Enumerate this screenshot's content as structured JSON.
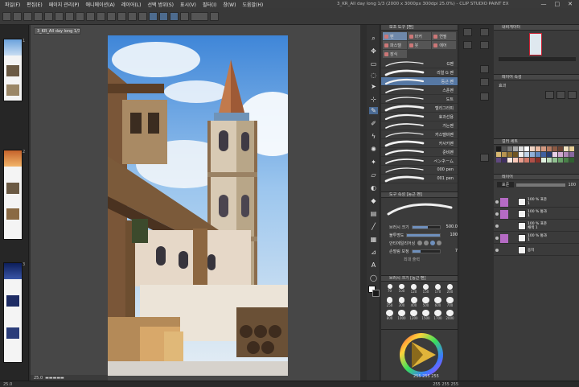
{
  "app": {
    "window_title": "3_KR_All day long 1/3 (2000 x 3000px 300dpi 25.0%) - CLIP STUDIO PAINT EX"
  },
  "menu": [
    "파일(F)",
    "편집(E)",
    "페이지 관리(P)",
    "애니메이션(A)",
    "레이어(L)",
    "선택 범위(S)",
    "표시(V)",
    "필터(I)",
    "창(W)",
    "도움말(H)"
  ],
  "window_controls": {
    "min": "—",
    "max": "□",
    "close": "✕"
  },
  "document_tab": "3_KR_All day long 1/3",
  "pages": [
    "1",
    "2",
    "3"
  ],
  "canvas_status": {
    "zoom": "25.0"
  },
  "subtool": {
    "header": "보조 도구 [펜]",
    "tabs": [
      {
        "label": "펜",
        "selected": true
      },
      {
        "label": "마커",
        "selected": false
      },
      {
        "label": "연필",
        "selected": false
      },
      {
        "label": "파스텔",
        "selected": false
      },
      {
        "label": "붓",
        "selected": false
      },
      {
        "label": "에어",
        "selected": false
      },
      {
        "label": "장식",
        "selected": false
      }
    ],
    "brushes": [
      "G펜",
      "리얼 G 펜",
      "둥근 펜",
      "스푼펜",
      "도트",
      "텔리그라피",
      "효과선용",
      "가는펜",
      "카스텔바펜",
      "카사카펜",
      "준비펜",
      "ペンネーム",
      "000 pen",
      "001 pen"
    ],
    "selected_index": 2
  },
  "tool_property": {
    "header": "도구 속성 [둥근 펜]",
    "rows": [
      {
        "label": "브러시 크기",
        "value": "500.0",
        "fill_fraction": 0.55
      },
      {
        "label": "불투명도",
        "value": "100",
        "fill_fraction": 1.0
      },
      {
        "label": "안티에일리어싱",
        "value": ""
      },
      {
        "label": "손떨림 보정",
        "value": "7",
        "fill_fraction": 0.3
      }
    ],
    "footer": "최대 출력"
  },
  "brush_size": {
    "header": "브러시 크기 [둥근 펜]",
    "sizes": [
      "70",
      "100",
      "120",
      "150",
      "170",
      "200",
      "250",
      "300",
      "400",
      "500",
      "600",
      "700",
      "800",
      "1000",
      "1200",
      "1500",
      "1700",
      "2000"
    ]
  },
  "color": {
    "h": "255",
    "s": "255",
    "v": "255"
  },
  "navigator": {
    "header": "내비게이터"
  },
  "layer_property": {
    "header": "레이어 속성",
    "mode": "효과"
  },
  "color_set": {
    "header": "컬러 세트",
    "swatches": [
      "#1a1a1a",
      "#555555",
      "#777777",
      "#a8a8a8",
      "#dddddd",
      "#ffffff",
      "#f0d4c4",
      "#e9b8a0",
      "#d49a82",
      "#b77a60",
      "#8c5a44",
      "#6b4434",
      "#f4e4c2",
      "#e8d096",
      "#d8b870",
      "#b89450",
      "#907030",
      "#705420",
      "#f0f0f0",
      "#c0d4e8",
      "#90b0d8",
      "#6088c0",
      "#4060a0",
      "#283c70",
      "#e8d0e8",
      "#d0a8d0",
      "#b088b8",
      "#8868a0",
      "#604880",
      "#403060",
      "#ffe8e0",
      "#f8c8b8",
      "#e8a090",
      "#d07868",
      "#b05048",
      "#883028",
      "#e0f0e0",
      "#b8d8b8",
      "#90c090",
      "#68a068",
      "#488048",
      "#306030"
    ]
  },
  "layers": {
    "header": "레이어",
    "blend_mode": "표준",
    "opacity": "100",
    "items": [
      {
        "name": "100 % 표준\n1",
        "accent": "#b56bc4"
      },
      {
        "name": "100 % 통과\n1",
        "accent": "#b56bc4"
      },
      {
        "name": "100 % 표준\n채색 1",
        "accent": ""
      },
      {
        "name": "100 % 통과\n1",
        "accent": "#b56bc4"
      },
      {
        "name": "용지",
        "accent": ""
      }
    ]
  },
  "status_bar": {
    "left": "25.0",
    "right": "255 255 255"
  }
}
